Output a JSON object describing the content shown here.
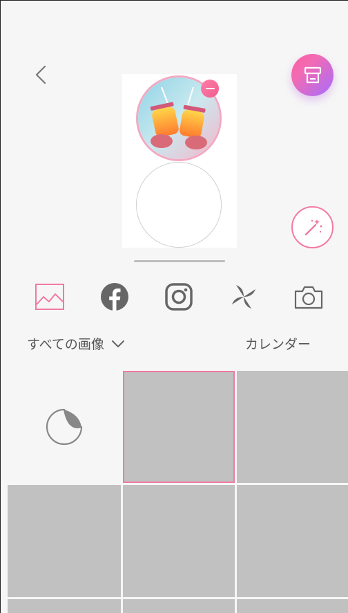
{
  "header": {
    "back_icon": "chevron-left-icon",
    "print_icon": "print-icon",
    "brand_gradient": [
      "#ff5fa0",
      "#a56cff"
    ],
    "accent": "#f07aa0"
  },
  "preview": {
    "remove_icon": "minus-icon",
    "photo_icon": "drinks-photo"
  },
  "effects": {
    "icon": "magic-wand-icon"
  },
  "sources": [
    {
      "name": "gallery",
      "icon": "image-icon",
      "selected": true
    },
    {
      "name": "facebook",
      "icon": "facebook-icon",
      "selected": false
    },
    {
      "name": "instagram",
      "icon": "instagram-icon",
      "selected": false
    },
    {
      "name": "pinwheel",
      "icon": "pinwheel-icon",
      "selected": false
    },
    {
      "name": "camera",
      "icon": "camera-icon",
      "selected": false
    }
  ],
  "filter": {
    "folder_label": "すべての画像",
    "calendar_label": "カレンダー"
  },
  "grid": {
    "sticker_icon": "sticker-peel-icon"
  }
}
